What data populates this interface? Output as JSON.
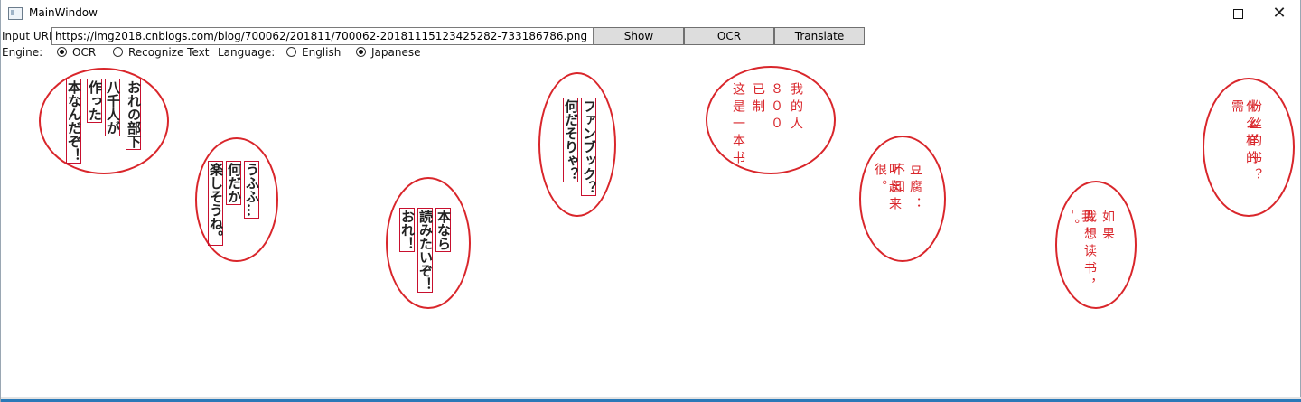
{
  "window": {
    "title": "MainWindow",
    "controls": [
      "minimize-icon",
      "maximize-icon",
      "close-icon"
    ]
  },
  "toolbar": {
    "url_label": "Input URL:",
    "url_value": "https://img2018.cnblogs.com/blog/700062/201811/700062-20181115123425282-733186786.png",
    "show_label": "Show",
    "ocr_label": "OCR",
    "translate_label": "Translate"
  },
  "options": {
    "engine_label": "Engine:",
    "engine_ocr": "OCR",
    "engine_recognize": "Recognize Text",
    "engine_selected": "OCR",
    "language_label": "Language:",
    "language_english": "English",
    "language_japanese": "Japanese",
    "language_selected": "Japanese"
  },
  "manga": {
    "bubble1": [
      "おれの部下",
      "八千人が",
      "作った",
      "本なんだぞ！"
    ],
    "bubble2": [
      "うふふ…",
      "何だか",
      "楽しそうね。"
    ],
    "bubble3": [
      "本なら",
      "読みたいぞ！",
      "おれ！"
    ],
    "bubble4": [
      "ファンブック？",
      "何だそりゃ？"
    ],
    "bubble5": [
      "我的人",
      "８００",
      "已制",
      "这是一本书"
    ],
    "bubble6": [
      "豆腐：",
      "不知",
      "听起来很。"
    ],
    "bubble7": [
      "如果",
      "我想读书，",
      "我--。"
    ],
    "bubble8": [
      "粉丝的书？",
      "什么样的需"
    ]
  },
  "colors": {
    "bubble_border": "#d9262b",
    "translated_text": "#d9262b",
    "ocr_box": "#c8102e",
    "window_edge": "#2a79b8"
  }
}
